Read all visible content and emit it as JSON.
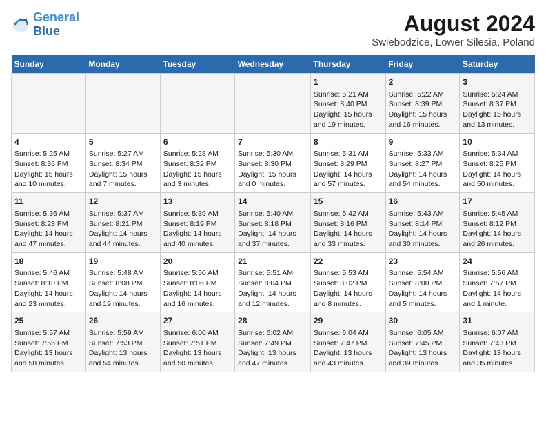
{
  "header": {
    "logo_line1": "General",
    "logo_line2": "Blue",
    "main_title": "August 2024",
    "subtitle": "Swiebodzice, Lower Silesia, Poland"
  },
  "days_of_week": [
    "Sunday",
    "Monday",
    "Tuesday",
    "Wednesday",
    "Thursday",
    "Friday",
    "Saturday"
  ],
  "weeks": [
    [
      {
        "day": "",
        "content": ""
      },
      {
        "day": "",
        "content": ""
      },
      {
        "day": "",
        "content": ""
      },
      {
        "day": "",
        "content": ""
      },
      {
        "day": "1",
        "content": "Sunrise: 5:21 AM\nSunset: 8:40 PM\nDaylight: 15 hours and 19 minutes."
      },
      {
        "day": "2",
        "content": "Sunrise: 5:22 AM\nSunset: 8:39 PM\nDaylight: 15 hours and 16 minutes."
      },
      {
        "day": "3",
        "content": "Sunrise: 5:24 AM\nSunset: 8:37 PM\nDaylight: 15 hours and 13 minutes."
      }
    ],
    [
      {
        "day": "4",
        "content": "Sunrise: 5:25 AM\nSunset: 8:36 PM\nDaylight: 15 hours and 10 minutes."
      },
      {
        "day": "5",
        "content": "Sunrise: 5:27 AM\nSunset: 8:34 PM\nDaylight: 15 hours and 7 minutes."
      },
      {
        "day": "6",
        "content": "Sunrise: 5:28 AM\nSunset: 8:32 PM\nDaylight: 15 hours and 3 minutes."
      },
      {
        "day": "7",
        "content": "Sunrise: 5:30 AM\nSunset: 8:30 PM\nDaylight: 15 hours and 0 minutes."
      },
      {
        "day": "8",
        "content": "Sunrise: 5:31 AM\nSunset: 8:29 PM\nDaylight: 14 hours and 57 minutes."
      },
      {
        "day": "9",
        "content": "Sunrise: 5:33 AM\nSunset: 8:27 PM\nDaylight: 14 hours and 54 minutes."
      },
      {
        "day": "10",
        "content": "Sunrise: 5:34 AM\nSunset: 8:25 PM\nDaylight: 14 hours and 50 minutes."
      }
    ],
    [
      {
        "day": "11",
        "content": "Sunrise: 5:36 AM\nSunset: 8:23 PM\nDaylight: 14 hours and 47 minutes."
      },
      {
        "day": "12",
        "content": "Sunrise: 5:37 AM\nSunset: 8:21 PM\nDaylight: 14 hours and 44 minutes."
      },
      {
        "day": "13",
        "content": "Sunrise: 5:39 AM\nSunset: 8:19 PM\nDaylight: 14 hours and 40 minutes."
      },
      {
        "day": "14",
        "content": "Sunrise: 5:40 AM\nSunset: 8:18 PM\nDaylight: 14 hours and 37 minutes."
      },
      {
        "day": "15",
        "content": "Sunrise: 5:42 AM\nSunset: 8:16 PM\nDaylight: 14 hours and 33 minutes."
      },
      {
        "day": "16",
        "content": "Sunrise: 5:43 AM\nSunset: 8:14 PM\nDaylight: 14 hours and 30 minutes."
      },
      {
        "day": "17",
        "content": "Sunrise: 5:45 AM\nSunset: 8:12 PM\nDaylight: 14 hours and 26 minutes."
      }
    ],
    [
      {
        "day": "18",
        "content": "Sunrise: 5:46 AM\nSunset: 8:10 PM\nDaylight: 14 hours and 23 minutes."
      },
      {
        "day": "19",
        "content": "Sunrise: 5:48 AM\nSunset: 8:08 PM\nDaylight: 14 hours and 19 minutes."
      },
      {
        "day": "20",
        "content": "Sunrise: 5:50 AM\nSunset: 8:06 PM\nDaylight: 14 hours and 16 minutes."
      },
      {
        "day": "21",
        "content": "Sunrise: 5:51 AM\nSunset: 8:04 PM\nDaylight: 14 hours and 12 minutes."
      },
      {
        "day": "22",
        "content": "Sunrise: 5:53 AM\nSunset: 8:02 PM\nDaylight: 14 hours and 8 minutes."
      },
      {
        "day": "23",
        "content": "Sunrise: 5:54 AM\nSunset: 8:00 PM\nDaylight: 14 hours and 5 minutes."
      },
      {
        "day": "24",
        "content": "Sunrise: 5:56 AM\nSunset: 7:57 PM\nDaylight: 14 hours and 1 minute."
      }
    ],
    [
      {
        "day": "25",
        "content": "Sunrise: 5:57 AM\nSunset: 7:55 PM\nDaylight: 13 hours and 58 minutes."
      },
      {
        "day": "26",
        "content": "Sunrise: 5:59 AM\nSunset: 7:53 PM\nDaylight: 13 hours and 54 minutes."
      },
      {
        "day": "27",
        "content": "Sunrise: 6:00 AM\nSunset: 7:51 PM\nDaylight: 13 hours and 50 minutes."
      },
      {
        "day": "28",
        "content": "Sunrise: 6:02 AM\nSunset: 7:49 PM\nDaylight: 13 hours and 47 minutes."
      },
      {
        "day": "29",
        "content": "Sunrise: 6:04 AM\nSunset: 7:47 PM\nDaylight: 13 hours and 43 minutes."
      },
      {
        "day": "30",
        "content": "Sunrise: 6:05 AM\nSunset: 7:45 PM\nDaylight: 13 hours and 39 minutes."
      },
      {
        "day": "31",
        "content": "Sunrise: 6:07 AM\nSunset: 7:43 PM\nDaylight: 13 hours and 35 minutes."
      }
    ]
  ]
}
